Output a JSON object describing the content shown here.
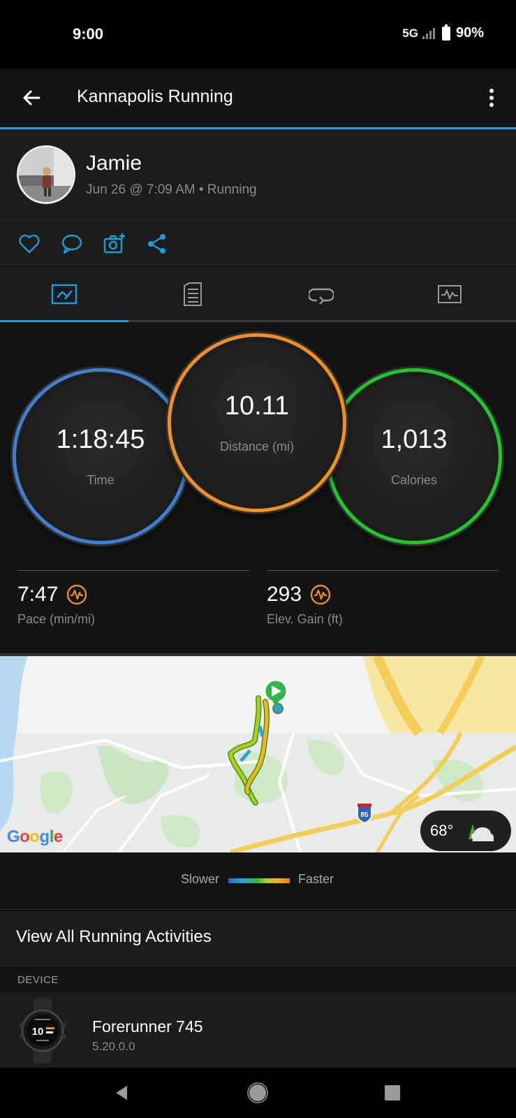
{
  "status_bar": {
    "time": "9:00",
    "network": "5G",
    "battery": "90%"
  },
  "app_bar": {
    "title": "Kannapolis Running",
    "back_icon": "arrow-left-icon",
    "menu_icon": "more-vert-icon"
  },
  "owner": {
    "name": "Jamie",
    "meta": "Jun 26 @ 7:09 AM • Running"
  },
  "actions": [
    "heart-icon",
    "comment-icon",
    "add-photo-icon",
    "share-icon"
  ],
  "tabs": [
    {
      "icon": "overview-icon",
      "active": true
    },
    {
      "icon": "details-icon",
      "active": false
    },
    {
      "icon": "laps-icon",
      "active": false
    },
    {
      "icon": "charts-icon",
      "active": false
    }
  ],
  "stats": {
    "time": {
      "value": "1:18:45",
      "label": "Time",
      "color": "#3d80cf"
    },
    "distance": {
      "value": "10.11",
      "label": "Distance (mi)",
      "color": "#f08f22"
    },
    "calories": {
      "value": "1,013",
      "label": "Calories",
      "color": "#1fc72b"
    }
  },
  "metrics": {
    "pace": {
      "value": "7:47",
      "label": "Pace (min/mi)"
    },
    "elevation": {
      "value": "293",
      "label": "Elev. Gain (ft)"
    }
  },
  "map": {
    "brand": "Google",
    "shield": "85",
    "weather_temp": "68°"
  },
  "legend": {
    "slower": "Slower",
    "faster": "Faster"
  },
  "view_all": "View All Running Activities",
  "device": {
    "header": "DEVICE",
    "name": "Forerunner 745",
    "version": "5.20.0.0",
    "watch_face_time": "10"
  },
  "colors": {
    "accent": "#1e9ed8",
    "background": "#141414"
  }
}
